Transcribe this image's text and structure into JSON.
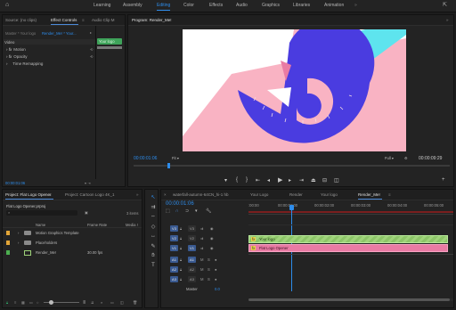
{
  "workspace_tabs": [
    "Learning",
    "Assembly",
    "Editing",
    "Color",
    "Effects",
    "Audio",
    "Graphics",
    "Libraries",
    "Animation"
  ],
  "active_workspace": "Editing",
  "source_panel": {
    "tabs": [
      "Source: (no clips)",
      "Effect Controls",
      "Audio Clip M"
    ],
    "active_tab": "Effect Controls",
    "master_label": "Master * Your logo",
    "clip_label": "Render_Me! * Your...",
    "section_video": "Video",
    "effects": [
      "Motion",
      "Opacity",
      "Time Remapping"
    ],
    "clip_badge": "Your logo",
    "timecode": "00:00:01:06"
  },
  "program_monitor": {
    "title": "Program: Render_Me!",
    "timecode_left": "00:00:01:06",
    "fit": "Fit",
    "quality": "Full",
    "timecode_right": "00:00:09:29"
  },
  "project_panel": {
    "tabs": [
      "Project: Flat Logo Opener",
      "Project: Cartoon Logo 4K_1"
    ],
    "file_name": "Flat Logo Opener.prproj",
    "item_count": "3 items",
    "columns": {
      "name": "Name",
      "frame_rate": "Frame Rate",
      "media": "Media !"
    },
    "items": [
      {
        "name": "Motion Graphics Template",
        "frame_rate": "",
        "color": "#e2a538",
        "type": "folder"
      },
      {
        "name": "Placeholders",
        "frame_rate": "",
        "color": "#e2a538",
        "type": "folder"
      },
      {
        "name": "Render_Me!",
        "frame_rate": "30.00 fps",
        "color": "#4caf50",
        "type": "sequence"
      }
    ]
  },
  "timeline": {
    "tabs": [
      "waterfall-autumn-64CN_hi-1 hb",
      "Your Logo",
      "Render",
      "Your logo",
      "Render_Me!"
    ],
    "active_tab": "Render_Me!",
    "timecode": "00:00:01:06",
    "ruler_labels": [
      ":00:00",
      "00:00:01:00",
      "00:00:02:00",
      "00:00:03:00",
      "00:00:04:00",
      "00:00:05:00"
    ],
    "tracks": [
      {
        "name": "V3",
        "source": "V3"
      },
      {
        "name": "V2",
        "source": "V2"
      },
      {
        "name": "V1",
        "source": "V1"
      },
      {
        "name": "A1",
        "source": "A1"
      },
      {
        "name": "A2",
        "source": "A2"
      },
      {
        "name": "A3",
        "source": "A3"
      }
    ],
    "clips": [
      {
        "track": "V1",
        "label": "Your logo",
        "color": "#9fd37a"
      },
      {
        "track": "V1b",
        "label": "Flat Logo Opener",
        "color": "#e97ba4"
      }
    ],
    "master_label": "Master",
    "master_value": "0.0"
  },
  "tools": [
    "selection-tool",
    "track-select-tool",
    "ripple-edit-tool",
    "razor-tool",
    "slip-tool",
    "pen-tool",
    "hand-tool",
    "type-tool"
  ],
  "colors": {
    "accent": "#2d8ceb",
    "clip_green": "#9fd37a",
    "clip_pink": "#e97ba4",
    "frame_pink": "#f9b3c3",
    "frame_purple": "#4a3ce0",
    "frame_cyan": "#5ee4ee"
  }
}
